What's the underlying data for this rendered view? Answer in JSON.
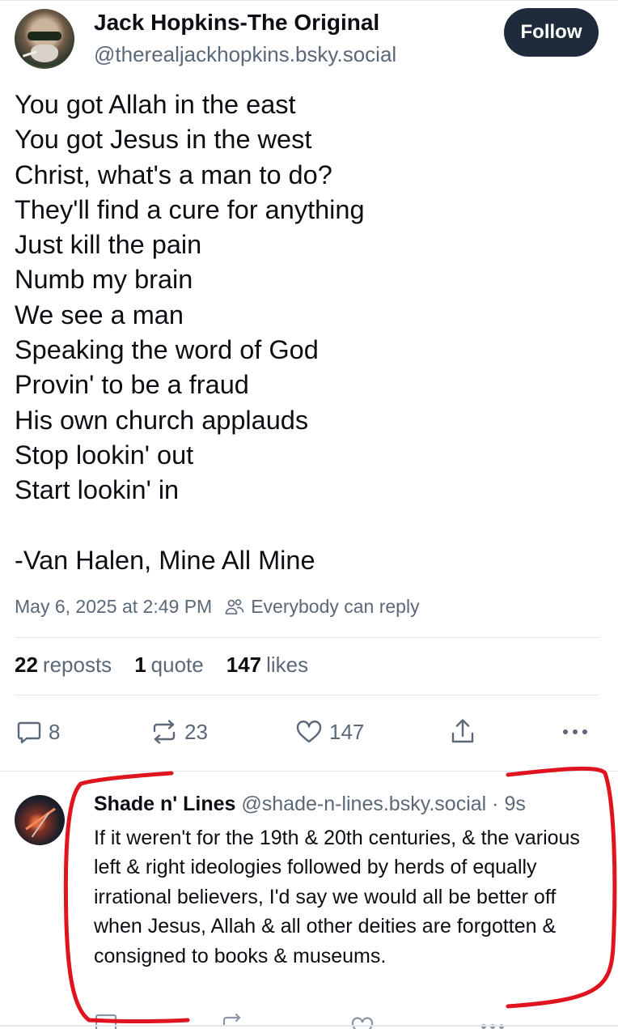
{
  "post": {
    "author": {
      "display_name": "Jack Hopkins-The Original",
      "handle": "@therealjackhopkins.bsky.social"
    },
    "follow_label": "Follow",
    "body_lines": [
      "You got Allah in the east",
      "You got Jesus in the west",
      "Christ, what's a man to do?",
      "They'll find a cure for anything",
      "Just kill the pain",
      "Numb my brain",
      "We see a man",
      "Speaking the word of God",
      "Provin' to be a fraud",
      "His own church applauds",
      "Stop lookin' out",
      "Start lookin' in",
      "",
      "-Van Halen, Mine All Mine"
    ],
    "timestamp": "May 6, 2025 at 2:49 PM",
    "reply_setting": "Everybody can reply",
    "stats": {
      "reposts_count": "22",
      "reposts_label": "reposts",
      "quotes_count": "1",
      "quotes_label": "quote",
      "likes_count": "147",
      "likes_label": "likes"
    },
    "actions": {
      "reply_count": "8",
      "repost_count": "23",
      "like_count": "147",
      "icons": [
        "reply-icon",
        "repost-icon",
        "heart-icon",
        "share-icon",
        "more-icon"
      ]
    }
  },
  "reply": {
    "author": {
      "display_name": "Shade n' Lines",
      "handle": "@shade-n-lines.bsky.social",
      "separator": "·",
      "age": "9s"
    },
    "text": "If it weren't for the 19th & 20th centuries, & the various left & right ideologies followed by herds of equally irrational believers, I'd say we would all be better off when Jesus, Allah & all other deities are forgotten & consigned to books & museums."
  },
  "colors": {
    "text": "#0b0f14",
    "muted": "#5a6878",
    "follow_bg": "#1f2b3a",
    "annotation": "#e0141e"
  }
}
